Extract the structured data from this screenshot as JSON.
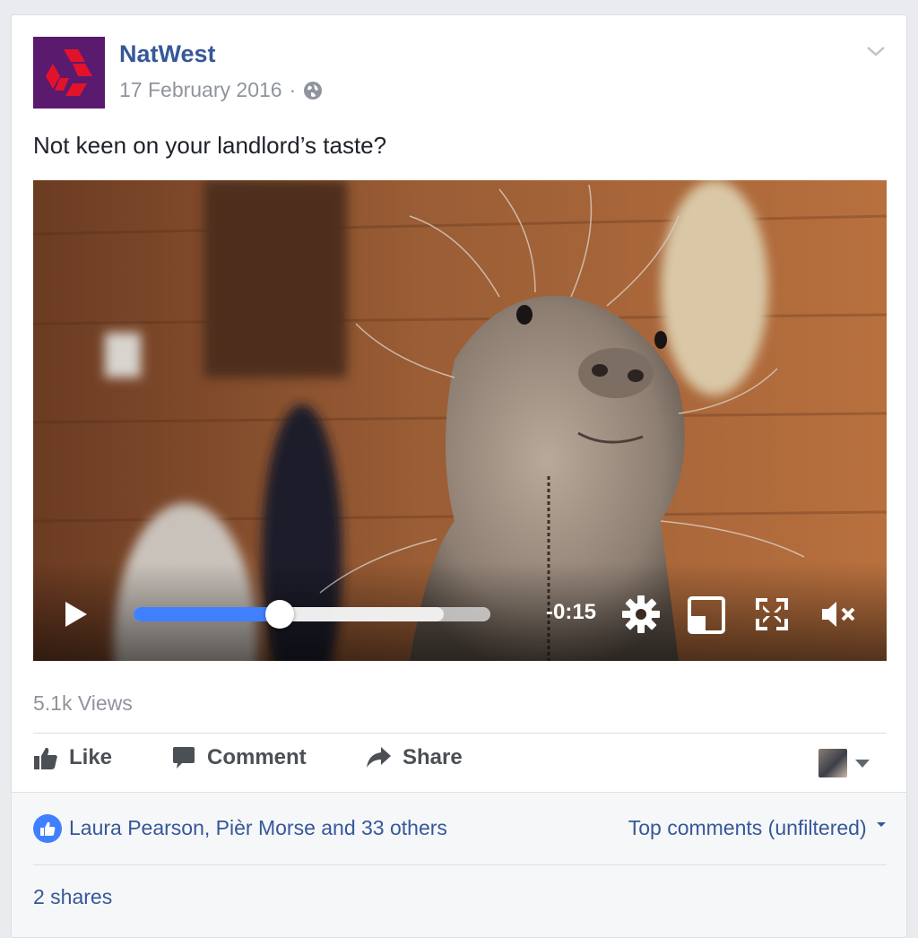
{
  "post": {
    "page_name": "NatWest",
    "date": "17 February 2016",
    "separator": "·",
    "privacy_icon": "globe-icon",
    "text": "Not keen on your landlord’s taste?"
  },
  "video": {
    "time_remaining": "-0:15",
    "progress": 0.41,
    "buffered": 0.87,
    "icons": [
      "play-icon",
      "gear-icon",
      "pip-icon",
      "fullscreen-icon",
      "mute-icon"
    ]
  },
  "stats": {
    "views": "5.1k Views"
  },
  "actions": {
    "like": "Like",
    "comment": "Comment",
    "share": "Share"
  },
  "footer": {
    "reactions": "Laura Pearson, Pièr Morse and 33 others",
    "top_comments": "Top comments (unfiltered)",
    "shares": "2 shares"
  },
  "colors": {
    "link": "#365899",
    "accent": "#4080ff",
    "muted": "#90949c",
    "brand_purple": "#5a1a6e",
    "brand_red": "#e3122b"
  }
}
